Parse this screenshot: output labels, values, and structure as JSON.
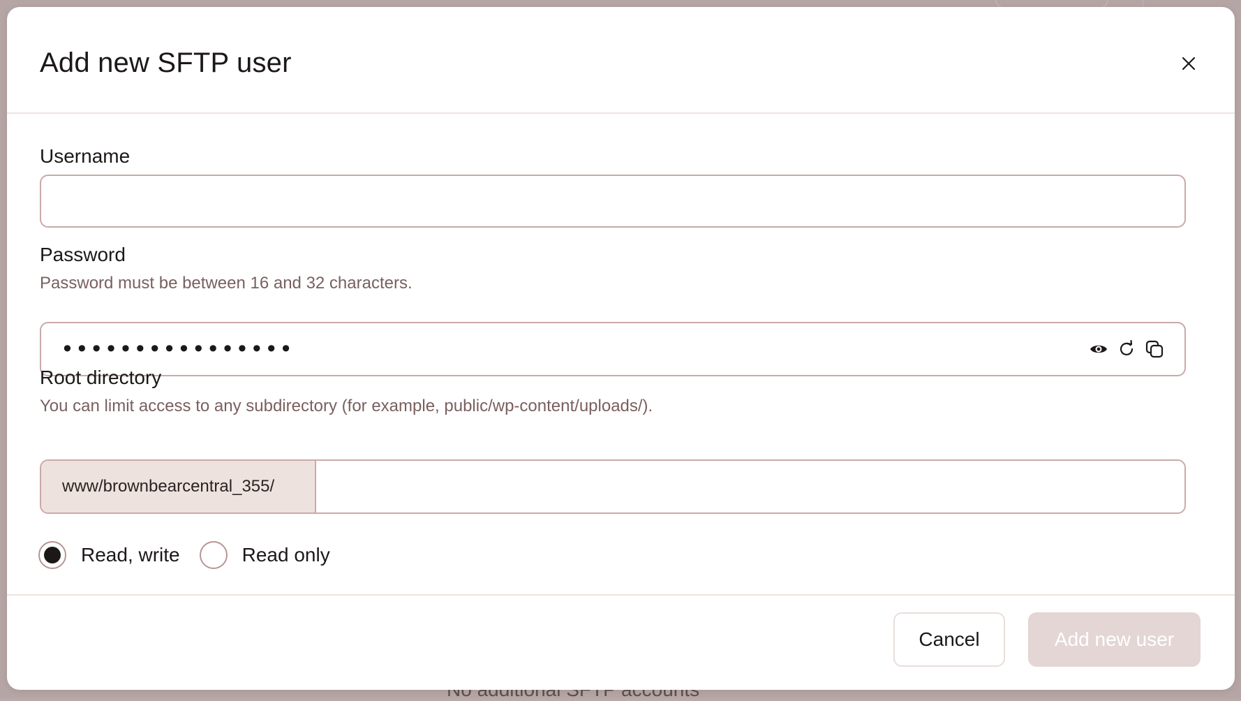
{
  "background": {
    "partial_text": "No additional SFTP accounts"
  },
  "modal": {
    "title": "Add new SFTP user",
    "close_icon": "close-icon",
    "username": {
      "label": "Username",
      "value": "",
      "placeholder": ""
    },
    "password": {
      "label": "Password",
      "help": "Password must be between 16 and 32 characters.",
      "masked_value": "••••••••••••••••",
      "icons": [
        "eye-icon",
        "refresh-icon",
        "copy-icon"
      ]
    },
    "root_directory": {
      "label": "Root directory",
      "help": "You can limit access to any subdirectory (for example, public/wp-content/uploads/).",
      "prefix": "www/brownbearcentral_355/",
      "value": ""
    },
    "permissions": {
      "options": [
        {
          "label": "Read, write",
          "selected": true
        },
        {
          "label": "Read only",
          "selected": false
        }
      ]
    },
    "footer": {
      "cancel_label": "Cancel",
      "submit_label": "Add new user"
    }
  },
  "colors": {
    "border": "#c9a9a8",
    "prefix_bg": "#eee2de",
    "help_text": "#7a5f5f",
    "disabled_primary": "#e3d6d5"
  }
}
